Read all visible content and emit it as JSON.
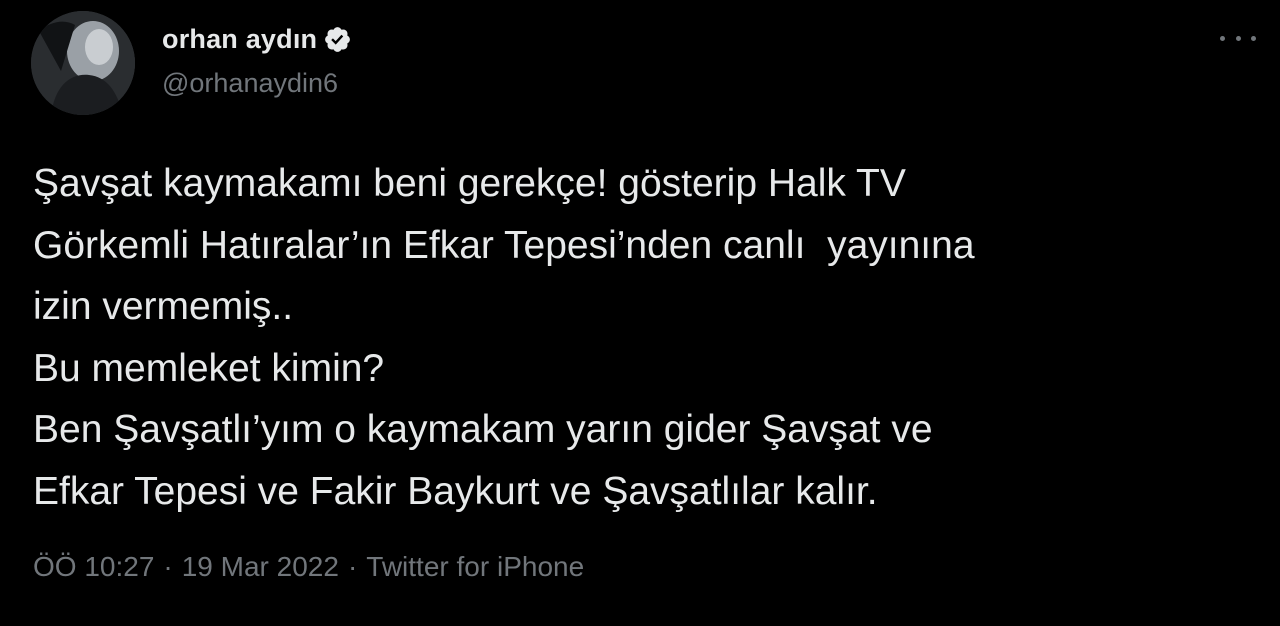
{
  "author": {
    "display_name": "orhan aydın",
    "handle": "@orhanaydin6",
    "verified": true,
    "verified_color": "#e7e9ea"
  },
  "tweet": {
    "lines": [
      "Şavşat kaymakamı beni gerekçe! gösterip Halk TV",
      "Görkemli Hatıralar’ın Efkar Tepesi’nden canlı  yayınına",
      "izin vermemiş..",
      "Bu memleket kimin?",
      "Ben Şavşatlı’yım o kaymakam yarın gider Şavşat ve",
      "Efkar Tepesi ve Fakir Baykurt ve Şavşatlılar kalır."
    ]
  },
  "meta": {
    "time": "ÖÖ 10:27",
    "separator": "·",
    "date": "19 Mar 2022",
    "source": "Twitter for iPhone"
  },
  "icons": {
    "more": "more-horizontal-icon",
    "verified": "verified-badge-icon"
  },
  "colors": {
    "background": "#000000",
    "text": "#e7e9ea",
    "secondary": "#71767b"
  }
}
